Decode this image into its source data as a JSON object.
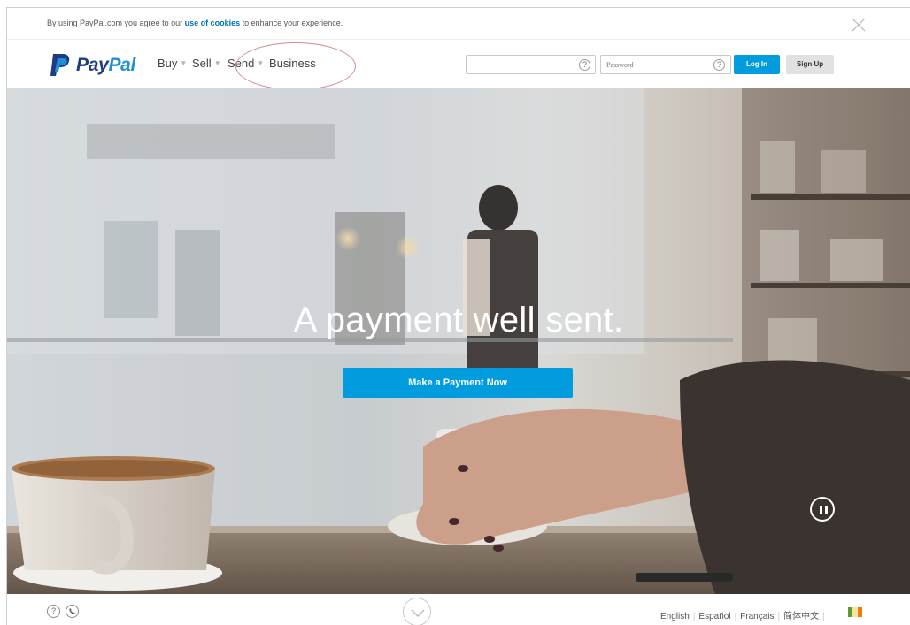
{
  "cookie_bar": {
    "text_before": "By using PayPal.com you agree to our ",
    "link": "use of cookies",
    "text_after": " to enhance your experience."
  },
  "header": {
    "logo": {
      "p": "Pay",
      "pal": "Pal"
    },
    "nav": [
      {
        "label": "Buy"
      },
      {
        "label": "Sell"
      },
      {
        "label": "Send"
      },
      {
        "label": "Business"
      }
    ],
    "email_field": {
      "value": "",
      "placeholder": ""
    },
    "password_field": {
      "value": "",
      "placeholder": "Password"
    },
    "help_glyph": "?",
    "login_label": "Log In",
    "signup_label": "Sign Up"
  },
  "hero": {
    "headline": "A payment well sent.",
    "cta_label": "Make a Payment Now"
  },
  "footer": {
    "languages": [
      "English",
      "Español",
      "Français",
      "简体中文"
    ]
  },
  "colors": {
    "brand_blue": "#009cde",
    "logo_dark": "#1f3b82",
    "logo_light": "#1c8fd8",
    "annotation_circle": "#d28b8b",
    "flag": [
      "#5a9e2f",
      "#f5e3a3",
      "#f07c00"
    ]
  }
}
